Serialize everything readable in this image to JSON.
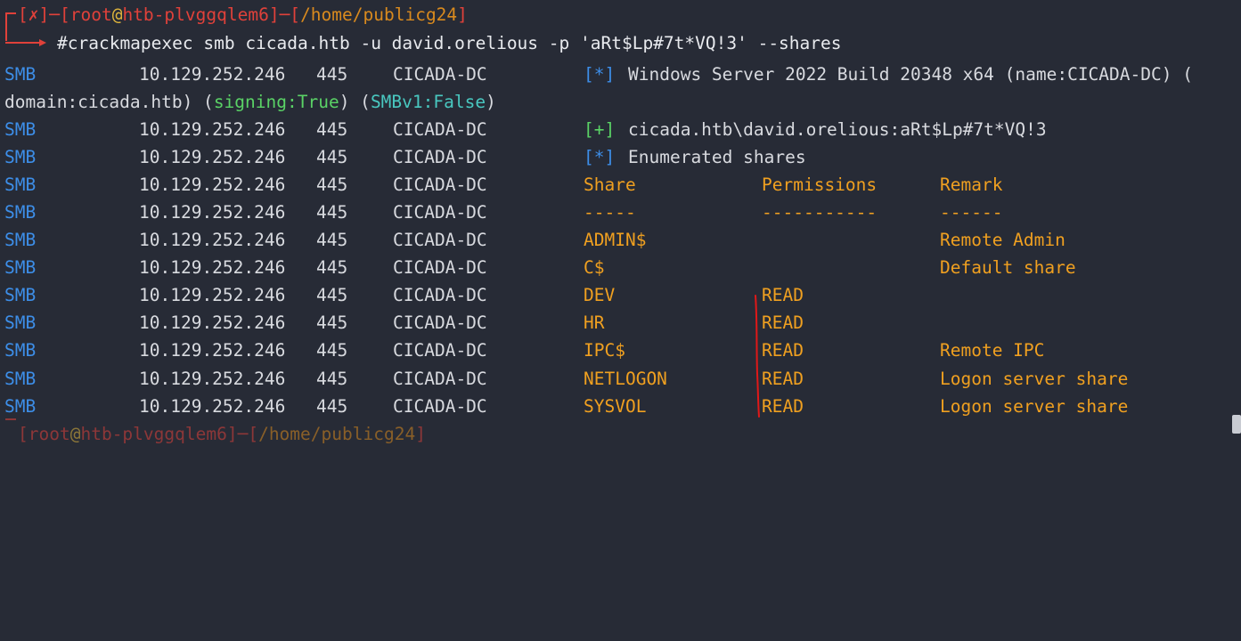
{
  "prompt": {
    "status": "✗",
    "user": "root",
    "at": "@",
    "host": "htb-plvggqlem6",
    "path": "/home/publicg24",
    "command": "#crackmapexec smb cicada.htb -u david.orelious -p 'aRt$Lp#7t*VQ!3' --shares"
  },
  "banner": {
    "proto": "SMB",
    "ip": "10.129.252.246",
    "port": "445",
    "host": "CICADA-DC",
    "marker": "[*]",
    "text": "Windows Server 2022 Build 20348 x64 (name:CICADA-DC) (",
    "wrap_domain": "domain:cicada.htb) (",
    "wrap_signing": "signing:True",
    "wrap_sep": ") (",
    "wrap_smbv1": "SMBv1:False",
    "wrap_close": ")"
  },
  "auth": {
    "proto": "SMB",
    "ip": "10.129.252.246",
    "port": "445",
    "host": "CICADA-DC",
    "marker": "[+]",
    "text": "cicada.htb\\david.orelious:aRt$Lp#7t*VQ!3"
  },
  "enum": {
    "proto": "SMB",
    "ip": "10.129.252.246",
    "port": "445",
    "host": "CICADA-DC",
    "marker": "[*]",
    "text": "Enumerated shares"
  },
  "share_header": {
    "proto": "SMB",
    "ip": "10.129.252.246",
    "port": "445",
    "host": "CICADA-DC",
    "share": "Share",
    "perm": "Permissions",
    "remark": "Remark"
  },
  "share_sep": {
    "proto": "SMB",
    "ip": "10.129.252.246",
    "port": "445",
    "host": "CICADA-DC",
    "share": "-----",
    "perm": "-----------",
    "remark": "------"
  },
  "shares": [
    {
      "proto": "SMB",
      "ip": "10.129.252.246",
      "port": "445",
      "host": "CICADA-DC",
      "share": "ADMIN$",
      "perm": "",
      "remark": "Remote Admin"
    },
    {
      "proto": "SMB",
      "ip": "10.129.252.246",
      "port": "445",
      "host": "CICADA-DC",
      "share": "C$",
      "perm": "",
      "remark": "Default share"
    },
    {
      "proto": "SMB",
      "ip": "10.129.252.246",
      "port": "445",
      "host": "CICADA-DC",
      "share": "DEV",
      "perm": "READ",
      "remark": ""
    },
    {
      "proto": "SMB",
      "ip": "10.129.252.246",
      "port": "445",
      "host": "CICADA-DC",
      "share": "HR",
      "perm": "READ",
      "remark": ""
    },
    {
      "proto": "SMB",
      "ip": "10.129.252.246",
      "port": "445",
      "host": "CICADA-DC",
      "share": "IPC$",
      "perm": "READ",
      "remark": "Remote IPC"
    },
    {
      "proto": "SMB",
      "ip": "10.129.252.246",
      "port": "445",
      "host": "CICADA-DC",
      "share": "NETLOGON",
      "perm": "READ",
      "remark": "Logon server share"
    },
    {
      "proto": "SMB",
      "ip": "10.129.252.246",
      "port": "445",
      "host": "CICADA-DC",
      "share": "SYSVOL",
      "perm": "READ",
      "remark": "Logon server share"
    }
  ],
  "next_prompt": {
    "user": "root",
    "at": "@",
    "host": "htb-plvggqlem6",
    "path": "/home/publicg24"
  },
  "colors": {
    "background": "#272b36",
    "proto": "#3d8ee8",
    "share_table": "#f0a020",
    "success_marker": "#5ad266",
    "info_marker": "#3d8ee8",
    "prompt": "#e0413a"
  }
}
